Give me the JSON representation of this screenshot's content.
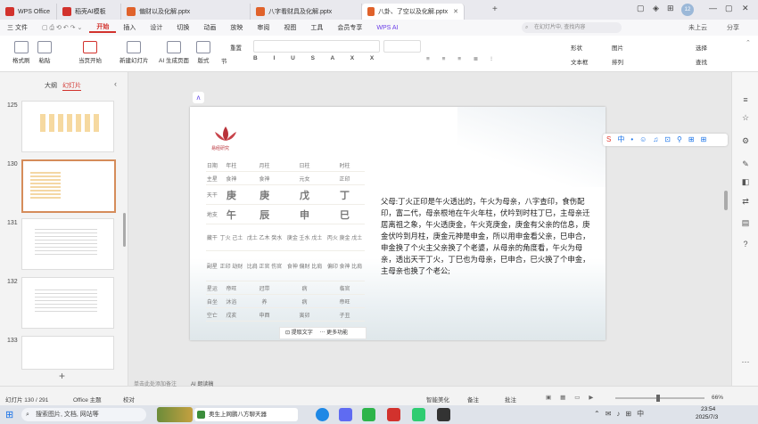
{
  "titlebar": {
    "home_tab": "WPS Office",
    "tabs": [
      "稻壳AI模板",
      "偏财以及化解.pptx",
      "八字看财具及化解.pptx",
      "八卦、了空以及化解.pptx"
    ],
    "account_badge": "12",
    "colors": {
      "wps_red": "#d2322d",
      "pptx_orange": "#e0622b"
    }
  },
  "menubar": {
    "file": "三 文件",
    "items": [
      "开始",
      "插入",
      "设计",
      "切换",
      "动画",
      "放映",
      "审阅",
      "视图",
      "工具",
      "会员专享",
      "WPS AI"
    ],
    "active": "开始",
    "search_placeholder": "在幻灯片中, 查找内容",
    "save_status": "未上云",
    "share": "分享"
  },
  "ribbon": {
    "format_painter": "格式刷",
    "paste": "粘贴",
    "from_current": "当页开始",
    "new_slide": "新建幻灯片",
    "ai_slides": "AI 生成页面",
    "layout": "版式",
    "section": "节",
    "reset": "重置",
    "shape": "形状",
    "picture": "图片",
    "textbox": "文本框",
    "arrange": "排列",
    "select": "选择",
    "find_replace": "查找",
    "group_label": "组合"
  },
  "leftpanel": {
    "tab_outline": "大纲",
    "tab_slides": "幻灯片",
    "slide_numbers": [
      "125",
      "130",
      "131",
      "132",
      "133"
    ],
    "add_slide": "+"
  },
  "slide": {
    "logo_text": "易经研究",
    "table": {
      "header": [
        "日期",
        "年柱",
        "月柱",
        "日柱",
        "时柱"
      ],
      "rows": [
        {
          "label": "主星",
          "cells": [
            "食神",
            "食神",
            "元女",
            "正印"
          ]
        },
        {
          "label": "天干",
          "cells": [
            "庚",
            "庚",
            "戊",
            "丁"
          ]
        },
        {
          "label": "地支",
          "cells": [
            "午",
            "辰",
            "申",
            "巳"
          ]
        },
        {
          "label": "藏干",
          "cells": [
            "丁火 己土",
            "戊土 乙木 癸水",
            "庚金 壬水 戊土",
            "丙火 庚金 戊土"
          ]
        },
        {
          "label": "副星",
          "cells": [
            "正印 劫财",
            "比肩 正官 伤官",
            "食神 偏财 比肩",
            "偏印 食神 比肩"
          ]
        },
        {
          "label": "星运",
          "cells": [
            "帝旺",
            "冠带",
            "病",
            "临官"
          ]
        },
        {
          "label": "自坐",
          "cells": [
            "沐浴",
            "养",
            "病",
            "帝旺"
          ]
        },
        {
          "label": "空亡",
          "cells": [
            "戌亥",
            "申酉",
            "寅卯",
            "子丑"
          ]
        }
      ]
    },
    "paragraph": "父母:丁火正印是午火透出的，午火为母亲，八字查印，食伤配印，富二代，母亲根地在午火年柱，伏吟到时柱丁巳，主母亲迁居离祖之象，午火透庚金，午火克庚金，庚金有父亲的信息，庚金伏吟到月柱，庚金元神是申金，所以用申金看父亲，巳申合，申金换了个火主父亲换了个老婆，从母亲的角度看，午火为母亲，透出天干丁火，丁巳也为母亲，巳申合，巳火换了个申金，主母亲也换了个老公;",
    "toolbar": {
      "extract_text": "提取文字",
      "more": "更多功能"
    }
  },
  "statusbar": {
    "slide_info": "幻灯片 130 / 291",
    "theme": "Office 主题",
    "proofread": "校对",
    "note_placeholder": "单击此处添加备注",
    "ai_note": "AI 朗读稿",
    "beautify": "智能美化",
    "notes": "备注",
    "comments": "批注",
    "zoom": "66%"
  },
  "taskbar": {
    "search_text": "搜索图片, 文档, 网站等",
    "active_window": "奥生上网鹏八方聊天器",
    "time": "23:54",
    "date": "2025/7/3"
  }
}
